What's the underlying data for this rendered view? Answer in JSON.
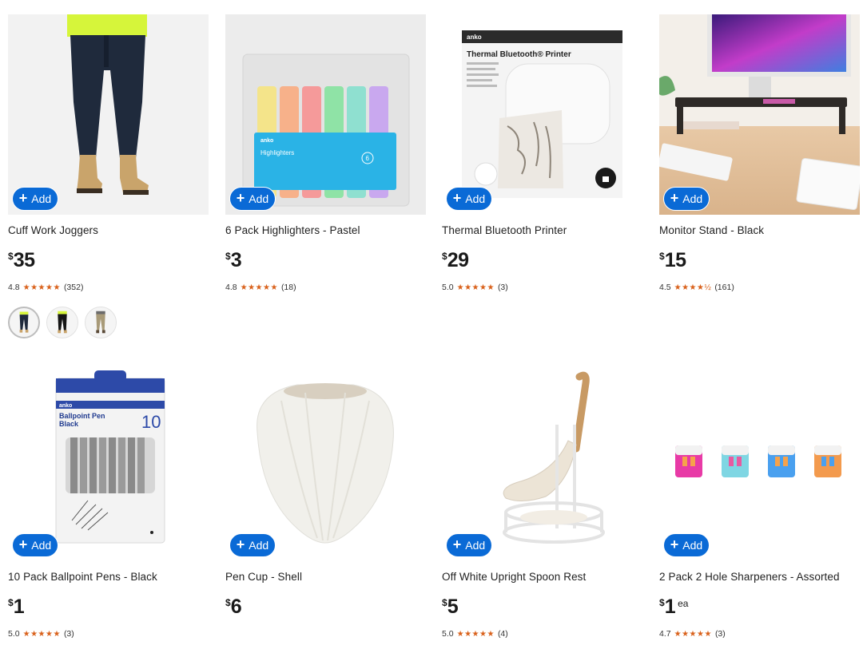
{
  "add_label": "Add",
  "products": [
    {
      "title": "Cuff Work Joggers",
      "currency": "$",
      "price": "35",
      "unit": "",
      "rating": "4.8",
      "stars": "★★★★★",
      "reviews": "(352)"
    },
    {
      "title": "6 Pack Highlighters - Pastel",
      "currency": "$",
      "price": "3",
      "unit": "",
      "rating": "4.8",
      "stars": "★★★★★",
      "reviews": "(18)",
      "package_brand": "anko",
      "package_label": "Highlighters",
      "package_count": "6"
    },
    {
      "title": "Thermal Bluetooth Printer",
      "currency": "$",
      "price": "29",
      "unit": "",
      "rating": "5.0",
      "stars": "★★★★★",
      "reviews": "(3)",
      "package_brand": "anko",
      "package_label": "Thermal Bluetooth® Printer"
    },
    {
      "title": "Monitor Stand - Black",
      "currency": "$",
      "price": "15",
      "unit": "",
      "rating": "4.5",
      "stars": "★★★★½",
      "reviews": "(161)"
    },
    {
      "title": "10 Pack Ballpoint Pens - Black",
      "currency": "$",
      "price": "1",
      "unit": "",
      "rating": "5.0",
      "stars": "★★★★★",
      "reviews": "(3)",
      "package_brand": "anko",
      "package_label_1": "Ballpoint Pen",
      "package_label_2": "Black",
      "package_count": "10"
    },
    {
      "title": "Pen Cup - Shell",
      "currency": "$",
      "price": "6",
      "unit": ""
    },
    {
      "title": "Off White Upright Spoon Rest",
      "currency": "$",
      "price": "5",
      "unit": "",
      "rating": "5.0",
      "stars": "★★★★★",
      "reviews": "(4)"
    },
    {
      "title": "2 Pack 2 Hole Sharpeners - Assorted",
      "currency": "$",
      "price": "1",
      "unit": "ea",
      "rating": "4.7",
      "stars": "★★★★★",
      "reviews": "(3)"
    }
  ],
  "colors": {
    "accent_blue": "#0a6ad6",
    "star_orange": "#d9611b"
  }
}
